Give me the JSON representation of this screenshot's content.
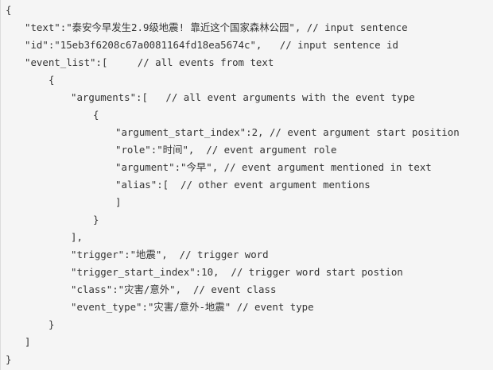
{
  "code": {
    "lines": [
      "{",
      "\"text\":\"泰安今早发生2.9级地震! 靠近这个国家森林公园\", // input sentence",
      "\"id\":\"15eb3f6208c67a0081164fd18ea5674c\",   // input sentence id",
      "\"event_list\":[     // all events from text",
      "{",
      "\"arguments\":[   // all event arguments with the event type",
      "{",
      "\"argument_start_index\":2, // event argument start position",
      "\"role\":\"时间\",  // event argument role",
      "\"argument\":\"今早\", // event argument mentioned in text",
      "\"alias\":[  // other event argument mentions",
      "]",
      "}",
      "],",
      "\"trigger\":\"地震\",  // trigger word",
      "\"trigger_start_index\":10,  // trigger word start postion",
      "\"class\":\"灾害/意外\",  // event class",
      "\"event_type\":\"灾害/意外-地震\" // event type",
      "}",
      "]",
      "}"
    ]
  }
}
